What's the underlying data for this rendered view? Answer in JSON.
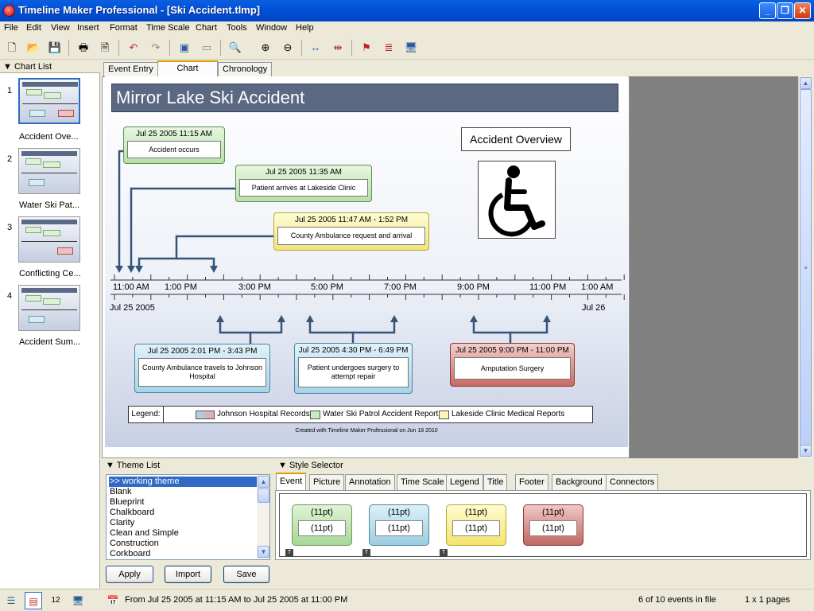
{
  "window": {
    "title": "Timeline Maker Professional - [Ski Accident.tlmp]",
    "minimize": "_",
    "restore": "❐",
    "close": "✕"
  },
  "menu": [
    "File",
    "Edit",
    "View",
    "Insert",
    "Format",
    "Time Scale",
    "Chart",
    "Tools",
    "Window",
    "Help"
  ],
  "chart_list": {
    "header": "Chart List",
    "items": [
      {
        "num": "1",
        "label": "Accident Ove..."
      },
      {
        "num": "2",
        "label": "Water Ski Pat..."
      },
      {
        "num": "3",
        "label": "Conflicting Ce..."
      },
      {
        "num": "4",
        "label": "Accident Sum..."
      }
    ]
  },
  "tabs": [
    "Event Entry",
    "Chart",
    "Chronology"
  ],
  "chart": {
    "title": "Mirror Lake Ski Accident",
    "overview_label": "Accident Overview",
    "events_above": [
      {
        "date": "Jul 25 2005 11:15 AM",
        "text": "Accident occurs",
        "style": "green"
      },
      {
        "date": "Jul 25 2005 11:35 AM",
        "text": "Patient arrives at Lakeside Clinic",
        "style": "green"
      },
      {
        "date": "Jul 25 2005 11:47 AM - 1:52 PM",
        "text": "County Ambulance request and arrival",
        "style": "yellow"
      }
    ],
    "events_below": [
      {
        "date": "Jul 25 2005 2:01 PM - 3:43 PM",
        "text": "County Ambulance travels to Johnson Hospital",
        "style": "blue"
      },
      {
        "date": "Jul 25 2005 4:30 PM - 6:49 PM",
        "text": "Patient undergoes surgery to attempt repair",
        "style": "blue"
      },
      {
        "date": "Jul 25 2005 9:00 PM - 11:00 PM",
        "text": "Amputation Surgery",
        "style": "red"
      }
    ],
    "time_labels": [
      "11:00 AM",
      "1:00 PM",
      "3:00 PM",
      "5:00 PM",
      "7:00 PM",
      "9:00 PM",
      "11:00 PM",
      "1:00 AM"
    ],
    "date_start": "Jul 25 2005",
    "date_end": "Jul 26",
    "legend": {
      "label": "Legend:",
      "items": [
        "Johnson Hospital Records",
        "Water Ski Patrol Accident Report",
        "Lakeside Clinic Medical Reports"
      ]
    },
    "footer": "Created with Timeline Maker Professional on Jun 18 2010"
  },
  "theme_list": {
    "header": "Theme List",
    "items": [
      ">> working theme",
      "Blank",
      "Blueprint",
      "Chalkboard",
      "Clarity",
      "Clean and Simple",
      "Construction",
      "Corkboard"
    ],
    "apply": "Apply",
    "import": "Import",
    "save": "Save"
  },
  "style_selector": {
    "header": "Style Selector",
    "tabs": [
      "Event",
      "Picture",
      "Annotation",
      "Time Scale",
      "Legend",
      "Title",
      "Footer",
      "Background",
      "Connectors"
    ],
    "swatches": [
      {
        "top": "(11pt)",
        "bottom": "(11pt)"
      },
      {
        "top": "(11pt)",
        "bottom": "(11pt)"
      },
      {
        "top": "(11pt)",
        "bottom": "(11pt)"
      },
      {
        "top": "(11pt)",
        "bottom": "(11pt)"
      }
    ],
    "t_icon": "T"
  },
  "status": {
    "range": "From Jul 25 2005 at 11:15 AM to Jul 25 2005 at 11:00 PM",
    "events": "6 of 10 events in file",
    "pages": "1 x 1 pages"
  },
  "colors": {
    "titlebar": "#0251d8",
    "accent_tab": "#e69a00",
    "chart_title_bg": "#5a6882",
    "connector": "#34547a"
  }
}
